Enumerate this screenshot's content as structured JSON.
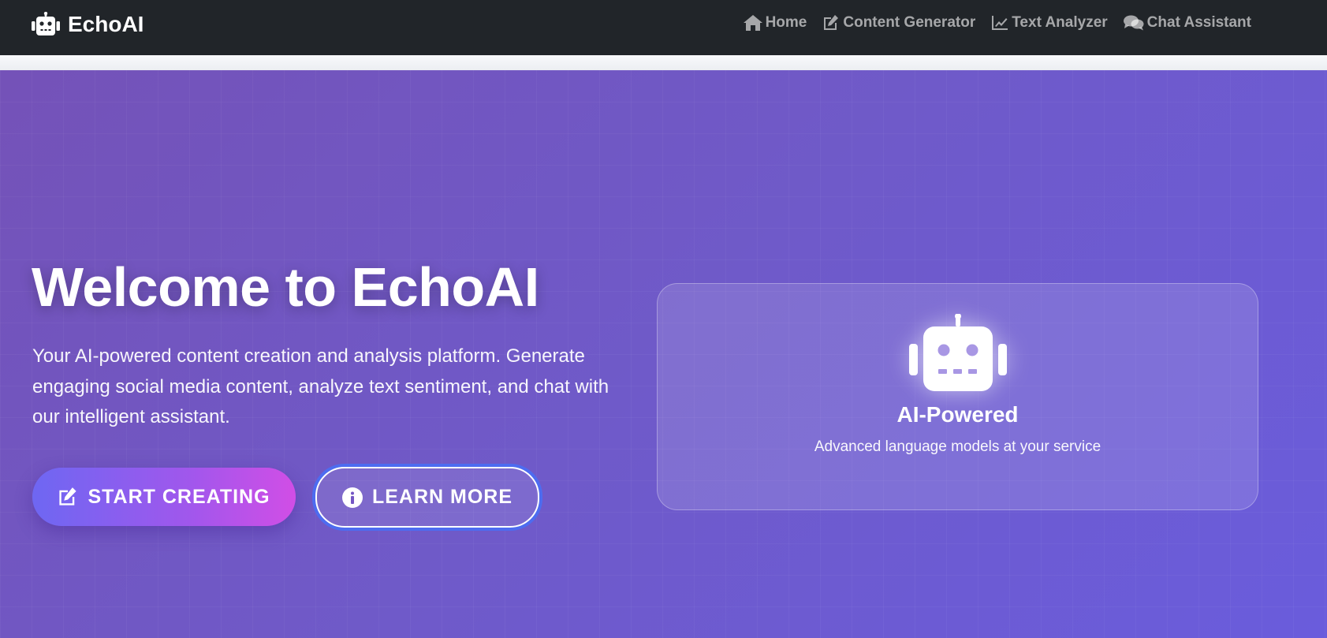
{
  "navbar": {
    "brand": "EchoAI",
    "brand_icon": "robot-icon",
    "links": [
      {
        "label": "Home",
        "icon": "home-icon"
      },
      {
        "label": "Content Generator",
        "icon": "edit-icon"
      },
      {
        "label": "Text Analyzer",
        "icon": "chart-line-icon"
      },
      {
        "label": "Chat Assistant",
        "icon": "comments-icon"
      }
    ]
  },
  "hero": {
    "title": "Welcome to EchoAI",
    "description": "Your AI-powered content creation and analysis platform. Generate engaging social media content, analyze text sentiment, and chat with our intelligent assistant.",
    "primary_button": {
      "label": "START CREATING",
      "icon": "edit-icon"
    },
    "secondary_button": {
      "label": "LEARN MORE",
      "icon": "info-circle-icon"
    }
  },
  "feature_card": {
    "icon": "robot-icon",
    "title": "AI-Powered",
    "subtitle": "Advanced language models at your service"
  },
  "colors": {
    "navbar_bg": "#212529",
    "hero_gradient_start": "#7452b8",
    "hero_gradient_end": "#6a5cdc",
    "primary_button_start": "#6e67f2",
    "primary_button_end": "#d14ee6",
    "focus_ring": "#4d6cf0"
  }
}
